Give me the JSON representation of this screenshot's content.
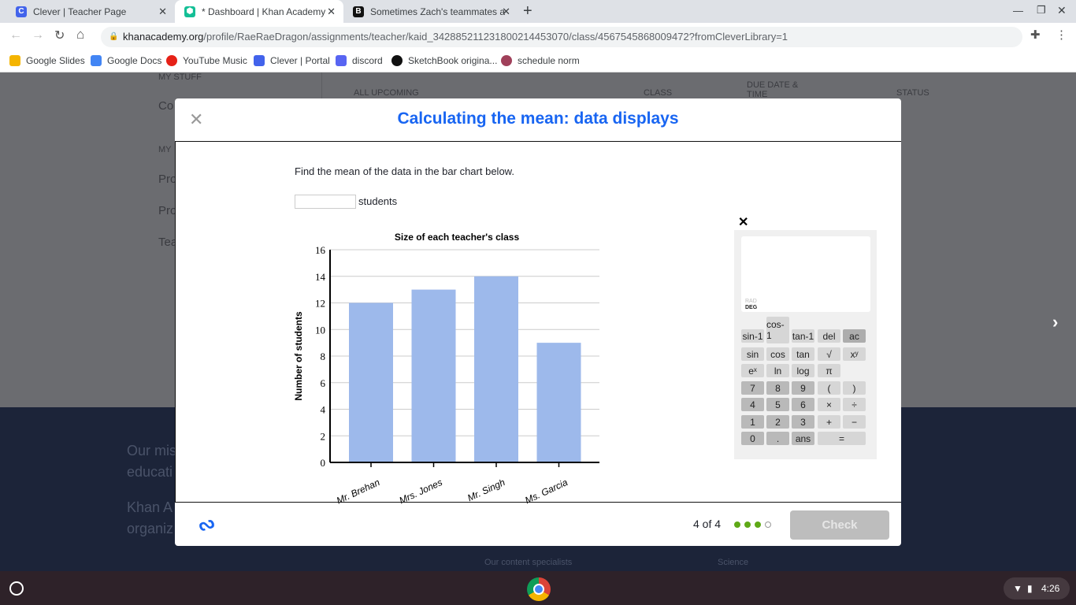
{
  "browser": {
    "tabs": [
      {
        "label": "Clever | Teacher Page"
      },
      {
        "label": "* Dashboard | Khan Academy"
      },
      {
        "label": "Sometimes Zach's teammates a"
      }
    ],
    "url_domain": "khanacademy.org",
    "url_path": "/profile/RaeRaeDragon/assignments/teacher/kaid_342885211231800214453070/class/4567545868009472?fromCleverLibrary=1",
    "bookmarks": [
      {
        "label": "Google Slides",
        "color": "#f4b400"
      },
      {
        "label": "Google Docs",
        "color": "#4285f4"
      },
      {
        "label": "YouTube Music",
        "color": "#e62117"
      },
      {
        "label": "Clever | Portal",
        "color": "#4263eb"
      },
      {
        "label": "discord",
        "color": "#5865f2"
      },
      {
        "label": "SketchBook origina...",
        "color": "#111111"
      },
      {
        "label": "schedule norm",
        "color": "#a0405a"
      }
    ]
  },
  "background": {
    "sidebar": [
      "MY STUFF",
      "Co",
      "MY",
      "Pro",
      "Pro",
      "Tea"
    ],
    "columns": [
      "ALL UPCOMING",
      "CLASS",
      "DUE DATE & TIME",
      "STATUS"
    ],
    "footer": [
      "Our mis",
      "educati",
      "Khan A",
      "organiz"
    ],
    "links": [
      "Our content specialists",
      "Science"
    ]
  },
  "modal": {
    "title": "Calculating the mean: data displays",
    "question": "Find the mean of the data in the bar chart below.",
    "answer_value": "",
    "answer_unit": "students",
    "progress": "4 of 4",
    "progress_done": 3,
    "progress_total": 4,
    "check_label": "Check"
  },
  "calculator": {
    "mode_rad": "RAD",
    "mode_deg": "DEG",
    "keys": [
      [
        "sin-1",
        "cos-1",
        "tan-1",
        "del",
        "ac"
      ],
      [
        "sin",
        "cos",
        "tan",
        "√",
        "xʸ"
      ],
      [
        "eˣ",
        "ln",
        "log",
        "π"
      ],
      [
        "7",
        "8",
        "9",
        "(",
        ")"
      ],
      [
        "4",
        "5",
        "6",
        "×",
        "÷"
      ],
      [
        "1",
        "2",
        "3",
        "+",
        "−"
      ],
      [
        "0",
        ".",
        "ans",
        "="
      ]
    ]
  },
  "chart_data": {
    "type": "bar",
    "title": "Size of each teacher's class",
    "xlabel": "",
    "ylabel": "Number of students",
    "categories": [
      "Mr. Brehan",
      "Mrs. Jones",
      "Mr. Singh",
      "Ms. Garcia"
    ],
    "values": [
      12,
      13,
      14,
      9
    ],
    "ylim": [
      0,
      16
    ],
    "yticks": [
      "0",
      "2",
      "4",
      "6",
      "8",
      "10",
      "12",
      "14",
      "16"
    ],
    "color": "#9db9eb"
  },
  "system": {
    "time": "4:26"
  }
}
